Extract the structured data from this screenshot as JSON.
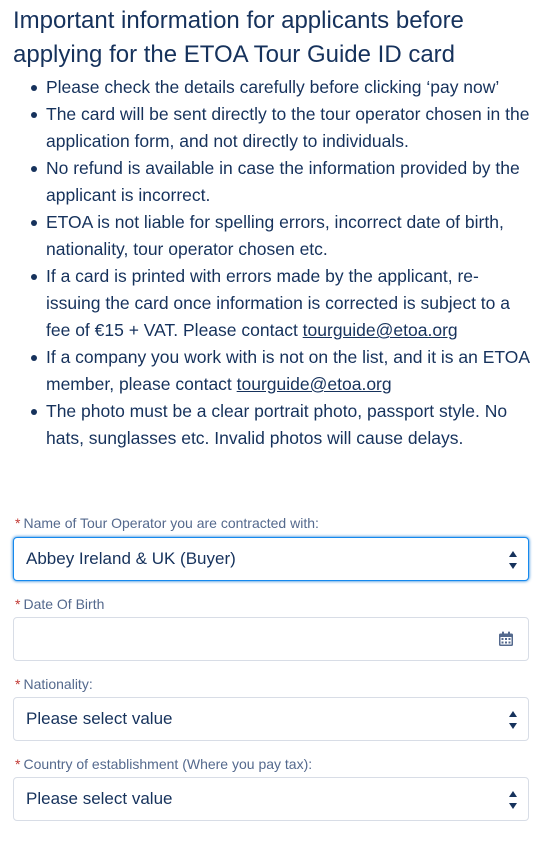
{
  "heading": "Important information for applicants before applying for the ETOA Tour Guide ID card",
  "info_items": [
    {
      "text": "Please check the details carefully before clicking ‘pay now’"
    },
    {
      "text": "The card will be sent directly to the tour operator chosen in the application form, and not directly to individuals."
    },
    {
      "text": "No refund is available in case the information provided by the applicant is incorrect."
    },
    {
      "text": "ETOA is not liable for spelling errors, incorrect date of birth, nationality, tour operator chosen etc."
    },
    {
      "text": "If a card is printed with errors made by the applicant, re-issuing the card once information is corrected is subject to a fee of €15 + VAT. Please contact ",
      "link": "tourguide@etoa.org"
    },
    {
      "text": "If a company you work with is not on the list, and it is an ETOA member, please contact ",
      "link": "tourguide@etoa.org"
    },
    {
      "text": "The photo must be a clear portrait photo, passport style. No hats, sunglasses etc. Invalid photos will cause delays."
    }
  ],
  "form": {
    "required_marker": "*",
    "tour_operator": {
      "label": "Name of Tour Operator you are contracted with:",
      "value": "Abbey Ireland & UK (Buyer)"
    },
    "date_of_birth": {
      "label": "Date Of Birth",
      "value": ""
    },
    "nationality": {
      "label": "Nationality:",
      "value": "Please select value"
    },
    "country_of_establishment": {
      "label": "Country of establishment (Where you pay tax):",
      "value": "Please select value"
    }
  },
  "icons": {
    "select_arrows": "up-down-chevron-icon",
    "date_picker": "calendar-icon"
  },
  "colors": {
    "text": "#16325c",
    "label": "#54698d",
    "required": "#c23934",
    "focus_border": "#1589ee",
    "input_border": "#d8dde6"
  }
}
